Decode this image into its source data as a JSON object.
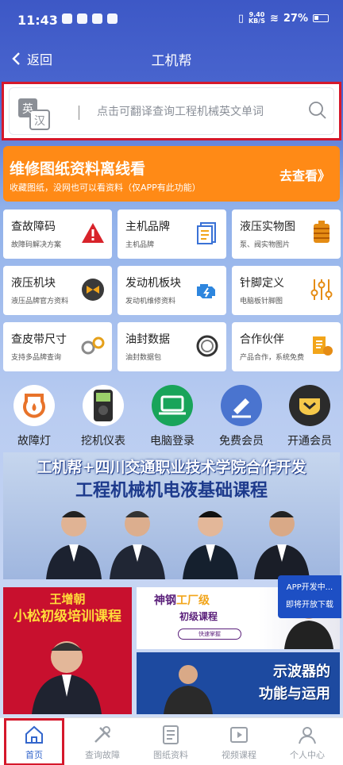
{
  "status_bar": {
    "time": "11:43",
    "net_speed_value": "9.40",
    "net_speed_unit": "KB/S",
    "battery": "27%"
  },
  "nav": {
    "back_label": "返回",
    "title": "工机帮"
  },
  "search": {
    "icon_zh": "汉",
    "icon_en": "英",
    "placeholder": "点击可翻译查询工程机械英文单词"
  },
  "banner": {
    "title": "维修图纸资料离线看",
    "subtitle": "收藏图纸，没网也可以看资料（仅APP有此功能）",
    "cta": "去查看》"
  },
  "grid": [
    {
      "title": "查故障码",
      "sub": "故障码解决方案",
      "icon": "warning-icon"
    },
    {
      "title": "主机品牌",
      "sub": "主机品牌",
      "icon": "document-icon"
    },
    {
      "title": "液压实物图",
      "sub": "泵、阀实物图片",
      "icon": "hydraulic-pump-icon"
    },
    {
      "title": "液压机块",
      "sub": "液压品牌官方资料",
      "icon": "valve-icon"
    },
    {
      "title": "发动机板块",
      "sub": "发动机维修资料",
      "icon": "engine-icon"
    },
    {
      "title": "针脚定义",
      "sub": "电脑板针脚图",
      "icon": "sliders-icon"
    },
    {
      "title": "查皮带尺寸",
      "sub": "支持多品牌查询",
      "icon": "belt-icon"
    },
    {
      "title": "油封数据",
      "sub": "油封数据包",
      "icon": "seal-ring-icon"
    },
    {
      "title": "合作伙伴",
      "sub": "产品合作，系统免费",
      "icon": "handshake-icon"
    }
  ],
  "circles": [
    {
      "label": "故障灯",
      "icon": "oil-drop-icon",
      "color": "#e8732a"
    },
    {
      "label": "挖机仪表",
      "icon": "meter-device-icon",
      "color": "#2d2d2d"
    },
    {
      "label": "电脑登录",
      "icon": "laptop-icon",
      "color": "#19a45a"
    },
    {
      "label": "免费会员",
      "icon": "pen-icon",
      "color": "#4a74cf"
    },
    {
      "label": "开通会员",
      "icon": "crown-icon",
      "color": "#2b2b2b"
    }
  ],
  "course_banner": {
    "line1": "工机帮+四川交通职业技术学院合作开发",
    "line2": "工程机械机电液基础课程"
  },
  "promo": {
    "line1": "APP开发中...",
    "line2": "即将开放下载"
  },
  "course_left": {
    "name": "王增朝",
    "title": "小松初级培训课程"
  },
  "course_right_top": {
    "brand": "神钢",
    "level": "工厂级",
    "sub": "初级课程",
    "pill": "快速掌握"
  },
  "course_right_bottom": {
    "l1": "示波器的",
    "l2": "功能与运用"
  },
  "tabs": [
    {
      "label": "首页",
      "icon": "home-icon"
    },
    {
      "label": "查询故障",
      "icon": "tools-icon"
    },
    {
      "label": "图纸资料",
      "icon": "drawing-doc-icon"
    },
    {
      "label": "视频课程",
      "icon": "video-icon"
    },
    {
      "label": "个人中心",
      "icon": "user-icon"
    }
  ]
}
